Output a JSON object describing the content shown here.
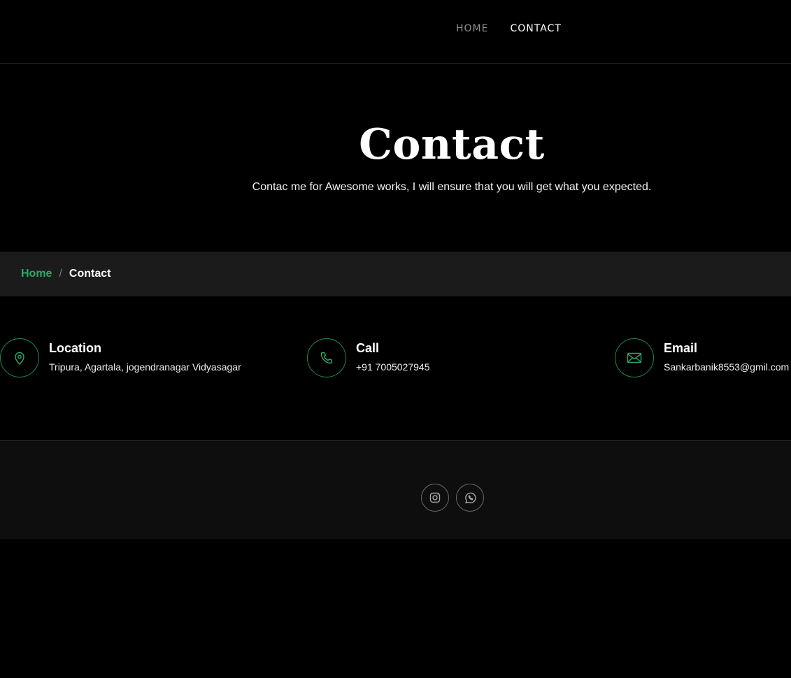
{
  "nav": {
    "items": [
      {
        "label": "HOME"
      },
      {
        "label": "CONTACT"
      }
    ]
  },
  "hero": {
    "title": "Contact",
    "subtitle": "Contac me for Awesome works, I will ensure that you will get what you expected."
  },
  "breadcrumb": {
    "home": "Home",
    "separator": "/",
    "current": "Contact"
  },
  "info": [
    {
      "icon": "map-pin-icon",
      "title": "Location",
      "value": "Tripura, Agartala, jogendranagar Vidyasagar"
    },
    {
      "icon": "phone-icon",
      "title": "Call",
      "value": "+91 7005027945"
    },
    {
      "icon": "envelope-icon",
      "title": "Email",
      "value": "Sankarbanik8553@gmil.com"
    }
  ],
  "footer": {
    "social": [
      {
        "icon": "instagram-icon"
      },
      {
        "icon": "whatsapp-icon"
      }
    ]
  },
  "colors": {
    "accent": "#2ea86a",
    "background": "#000000",
    "breadcrumb_bg": "#1b1b1b",
    "footer_bg": "#0e0e0e"
  }
}
